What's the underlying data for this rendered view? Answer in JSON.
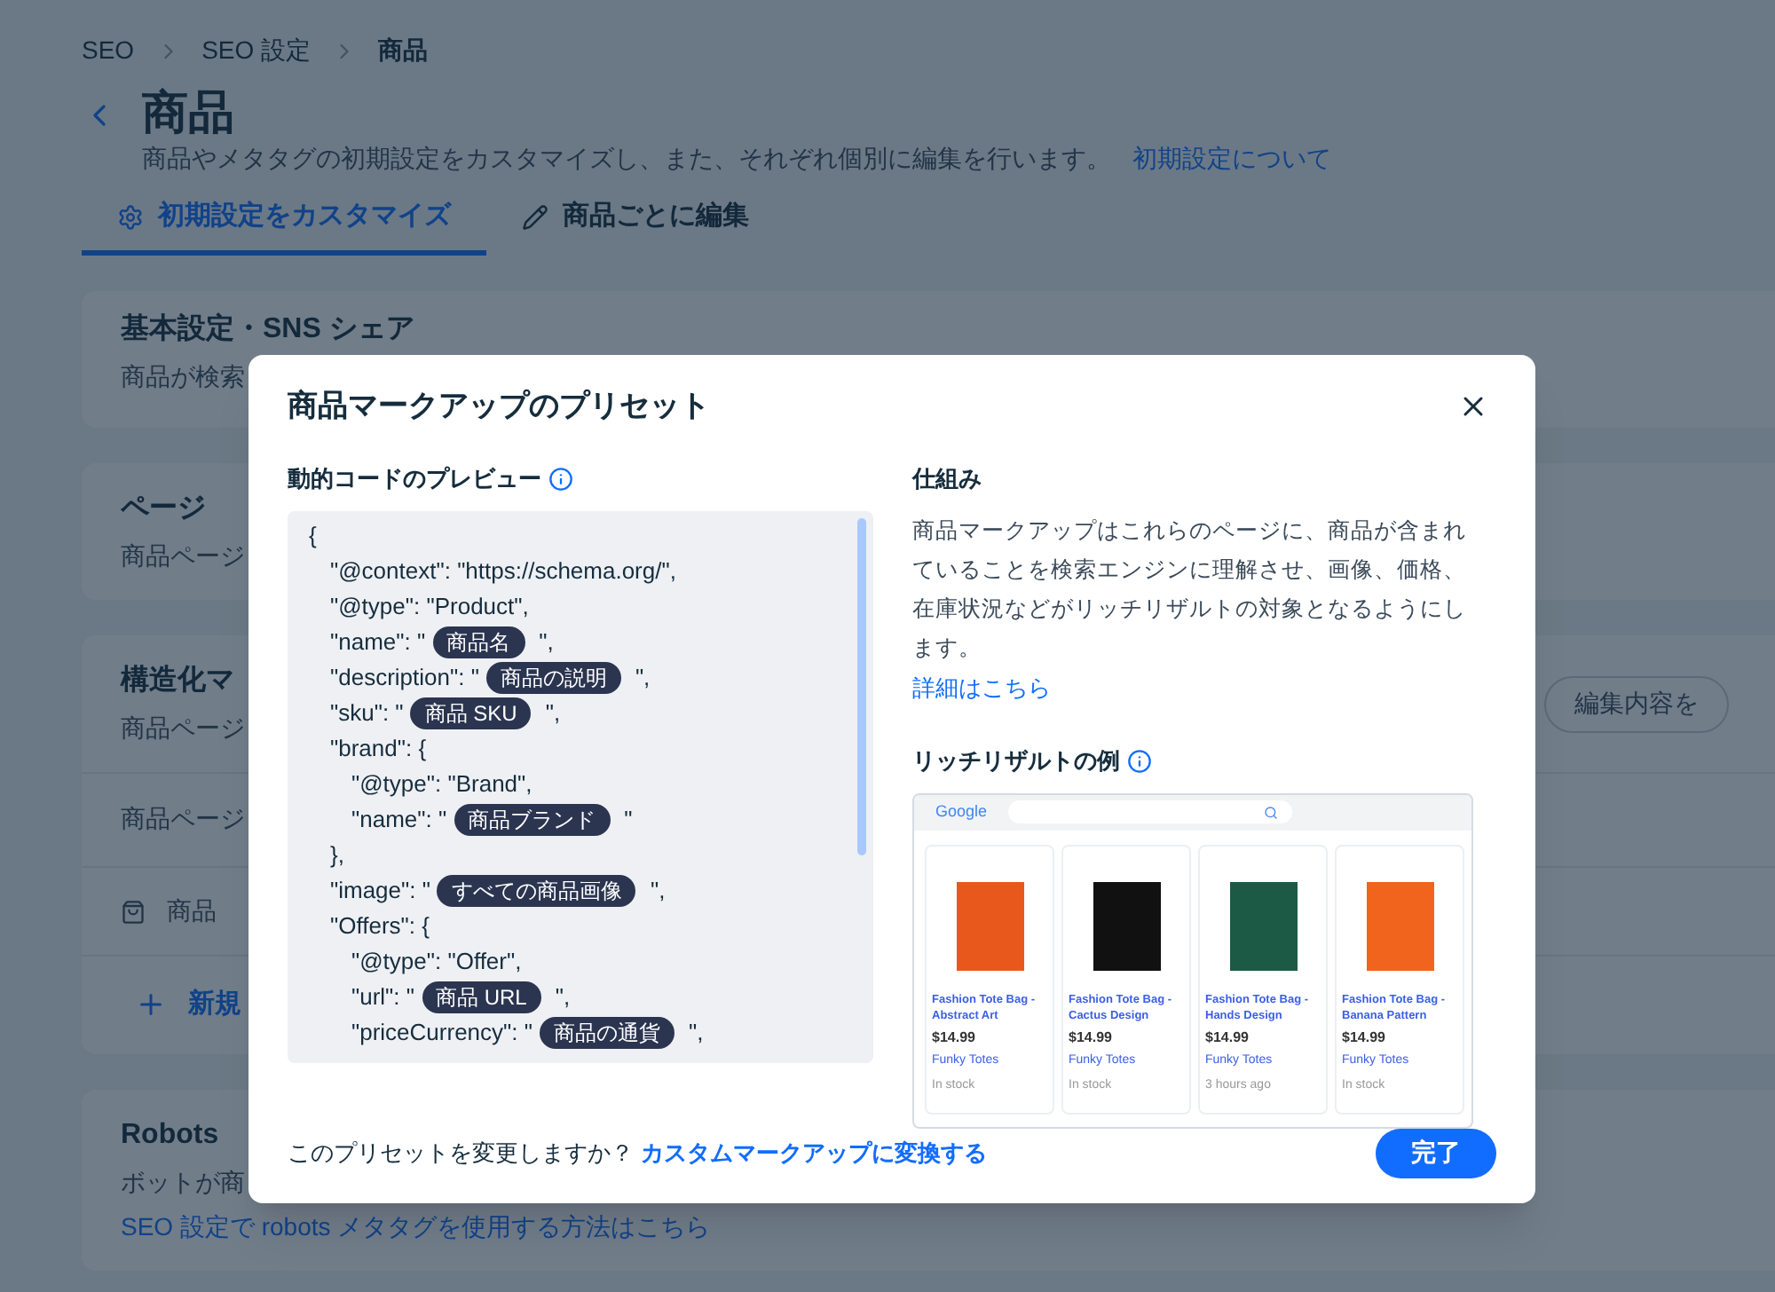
{
  "breadcrumbs": [
    "SEO",
    "SEO 設定",
    "商品"
  ],
  "page": {
    "title": "商品",
    "description": "商品やメタタグの初期設定をカスタマイズし、また、それぞれ個別に編集を行います。",
    "link": "初期設定について"
  },
  "tabs": [
    {
      "label": "初期設定をカスタマイズ",
      "selected": true
    },
    {
      "label": "商品ごとに編集",
      "selected": false
    }
  ],
  "sections": [
    {
      "title": "基本設定・SNS シェア",
      "subtitle": "商品が検索"
    },
    {
      "title": "ページ",
      "subtitle": "商品ページ"
    },
    {
      "title": "構造化マ",
      "subtitle": "商品ページ",
      "action": "編集内容を",
      "rows": [
        {
          "kind": "note",
          "text": "商品ページ"
        },
        {
          "kind": "markup",
          "text": "商品"
        },
        {
          "kind": "add",
          "text": "新規"
        }
      ]
    },
    {
      "title": "Robots",
      "subtitle": "ボットが商",
      "link": "SEO 設定で robots メタタグを使用する方法はこちら"
    }
  ],
  "dialog": {
    "title": "商品マークアップのプリセット",
    "preview_label": "動的コードのプレビュー",
    "code": [
      {
        "text": "{",
        "children": [
          {
            "text": "\"@context\": \"https://schema.org/\","
          },
          {
            "text": "\"@type\": \"Product\","
          },
          {
            "text": "\"name\": \"",
            "token": "商品名",
            "after": "\","
          },
          {
            "text": "\"description\": \"",
            "token": "商品の説明",
            "after": "\","
          },
          {
            "text": "\"sku\": \"",
            "token": "商品 SKU",
            "after": "\","
          },
          {
            "text": "\"brand\": {",
            "children": [
              {
                "text": "\"@type\": \"Brand\","
              },
              {
                "text": "\"name\": \"",
                "token": "商品ブランド",
                "after": "\""
              }
            ]
          },
          {
            "text": "},"
          },
          {
            "text": "\"image\": \"",
            "token": "すべての商品画像",
            "after": "\","
          },
          {
            "text": "\"Offers\": {",
            "children": [
              {
                "text": "\"@type\": \"Offer\","
              },
              {
                "text": "\"url\": \"",
                "token": "商品 URL",
                "after": "\","
              },
              {
                "text": "\"priceCurrency\": \"",
                "token": "商品の通貨",
                "after": "\","
              }
            ]
          }
        ]
      }
    ],
    "how_title": "仕組み",
    "how_text": "商品マークアップはこれらのページに、商品が含まれていることを検索エンジンに理解させ、画像、価格、在庫状況などがリッチリザルトの対象となるようにします。",
    "how_link": "詳細はこちら",
    "example_title": "リッチリザルトの例",
    "example": {
      "logo": "Google",
      "products": [
        {
          "name": [
            "Fashion Tote Bag -",
            "Abstract Art"
          ],
          "price": "$14.99",
          "store": "Funky Totes",
          "status": "In stock",
          "color": "#e8581c"
        },
        {
          "name": [
            "Fashion Tote Bag -",
            "Cactus Design"
          ],
          "price": "$14.99",
          "store": "Funky Totes",
          "status": "In stock",
          "color": "#111111"
        },
        {
          "name": [
            "Fashion Tote Bag -",
            "Hands Design"
          ],
          "price": "$14.99",
          "store": "Funky Totes",
          "status": "3 hours ago",
          "color": "#1d5a45"
        },
        {
          "name": [
            "Fashion Tote Bag -",
            "Banana Pattern"
          ],
          "price": "$14.99",
          "store": "Funky Totes",
          "status": "In stock",
          "color": "#f0641e"
        }
      ]
    },
    "footer_question": "このプリセットを変更しますか？",
    "footer_link": "カスタムマークアップに変換する",
    "done_button": "完了"
  }
}
